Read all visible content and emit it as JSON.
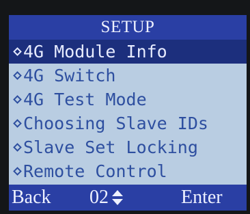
{
  "header": {
    "title": "SETUP"
  },
  "menu": {
    "items": [
      {
        "label": "4G Module Info",
        "icon": "bullet-icon"
      },
      {
        "label": "4G Switch",
        "icon": "bullet-icon"
      },
      {
        "label": "4G Test Mode",
        "icon": "bullet-icon"
      },
      {
        "label": "Choosing Slave IDs",
        "icon": "bullet-icon"
      },
      {
        "label": "Slave Set Locking",
        "icon": "bullet-icon"
      },
      {
        "label": "Remote Control",
        "icon": "bullet-icon"
      }
    ]
  },
  "footer": {
    "back_label": "Back",
    "page_number": "02",
    "page_icon": "up-down-arrow-icon",
    "enter_label": "Enter"
  },
  "colors": {
    "bar_blue": "#2a3fa4",
    "selection_navy": "#1c2f7d",
    "lcd_background": "#b9cde2",
    "menu_text": "#2e4fa0",
    "bar_text": "#eef1ff"
  }
}
